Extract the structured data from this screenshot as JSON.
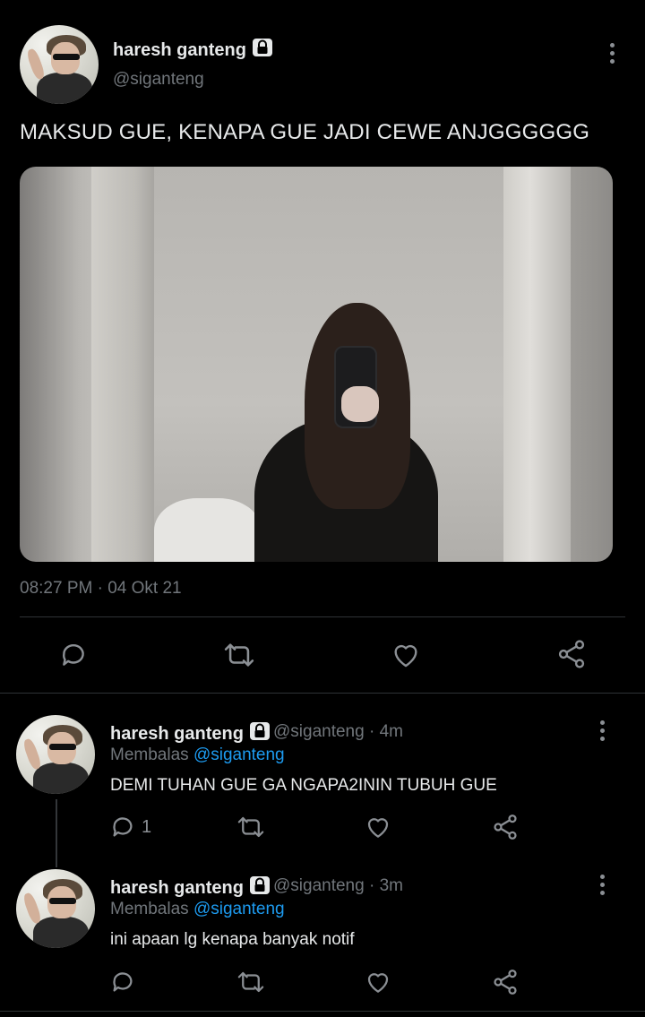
{
  "main_tweet": {
    "display_name": "haresh ganteng",
    "handle": "@siganteng",
    "text": "MAKSUD GUE, KENAPA GUE JADI CEWE ANJGGGGGG",
    "timestamp": "08:27 PM · 04 Okt 21",
    "media_description_icon": "photo"
  },
  "replies": [
    {
      "display_name": "haresh ganteng",
      "handle": "@siganteng",
      "time": "· 4m",
      "replying_prefix": "Membalas",
      "replying_to": "@siganteng",
      "text": "DEMI TUHAN GUE GA NGAPA2ININ TUBUH GUE",
      "reply_count": "1"
    },
    {
      "display_name": "haresh ganteng",
      "handle": "@siganteng",
      "time": "· 3m",
      "replying_prefix": "Membalas",
      "replying_to": "@siganteng",
      "text": "ini apaan lg kenapa banyak notif",
      "reply_count": ""
    }
  ],
  "icons": {
    "reply": "reply-icon",
    "retweet": "retweet-icon",
    "like": "heart-icon",
    "share": "share-icon",
    "lock": "lock-icon",
    "more": "more-vertical-icon"
  },
  "colors": {
    "background": "#000000",
    "text": "#e7e9ea",
    "muted": "#71767b",
    "accent": "#1d9bf0",
    "divider": "#2f3336"
  }
}
